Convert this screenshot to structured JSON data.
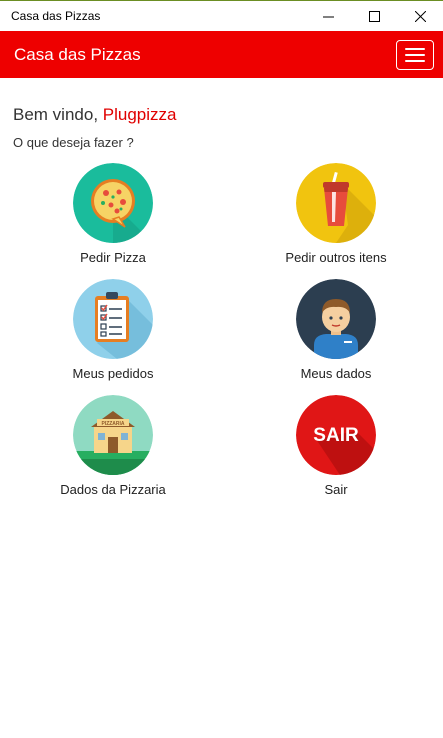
{
  "window": {
    "title": "Casa das Pizzas"
  },
  "navbar": {
    "brand": "Casa das Pizzas"
  },
  "main": {
    "greeting_prefix": "Bem vindo, ",
    "user_name": "Plugpizza",
    "question": "O que deseja fazer ?",
    "tiles": [
      {
        "label": "Pedir Pizza",
        "icon": "pizza-icon",
        "color": "#1abc9c"
      },
      {
        "label": "Pedir outros itens",
        "icon": "soda-cup-icon",
        "color": "#f1c40f"
      },
      {
        "label": "Meus pedidos",
        "icon": "clipboard-checklist-icon",
        "color": "#8fd0ea"
      },
      {
        "label": "Meus dados",
        "icon": "user-avatar-icon",
        "color": "#2c3e50"
      },
      {
        "label": "Dados da Pizzaria",
        "icon": "pizzeria-house-icon",
        "color": "#8fdac2"
      },
      {
        "label": "Sair",
        "icon": "sair-exit-icon",
        "color": "#e01616",
        "icon_text": "SAIR"
      }
    ],
    "pizzeria_sign": "PIZZARIA"
  },
  "colors": {
    "accent": "#ee0000",
    "user_name": "#e00000"
  }
}
